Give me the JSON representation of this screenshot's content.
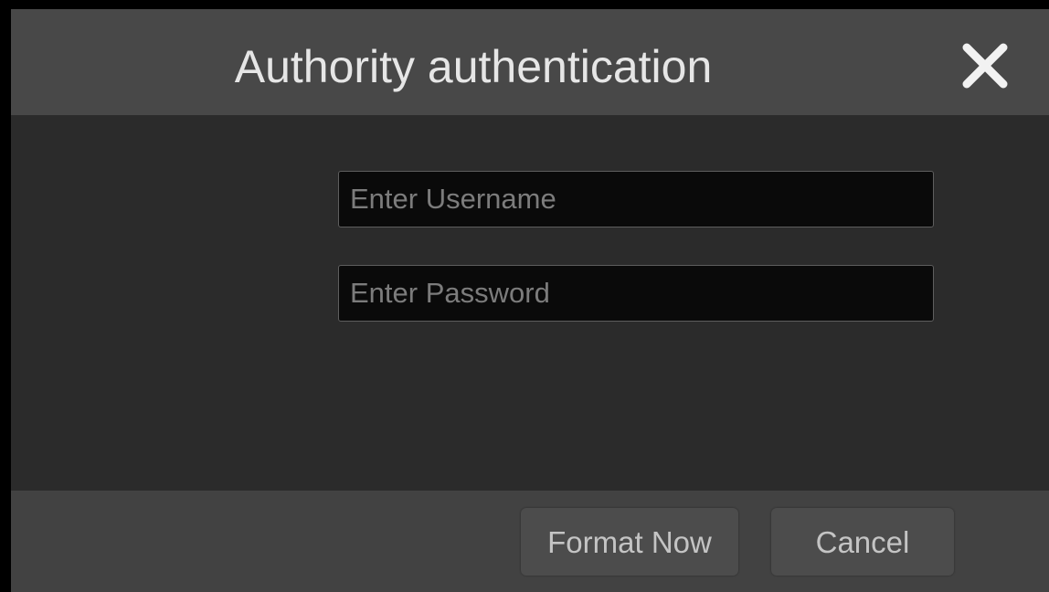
{
  "dialog": {
    "title": "Authority authentication",
    "close_icon": "close-icon"
  },
  "form": {
    "username_placeholder": "Enter Username",
    "username_value": "",
    "password_placeholder": "Enter Password",
    "password_value": ""
  },
  "footer": {
    "format_label": "Format Now",
    "cancel_label": "Cancel"
  },
  "colors": {
    "titlebar": "#484848",
    "body": "#2b2b2b",
    "footer": "#424242",
    "field_bg": "#0a0a0a",
    "text": "#e6e6e6"
  }
}
